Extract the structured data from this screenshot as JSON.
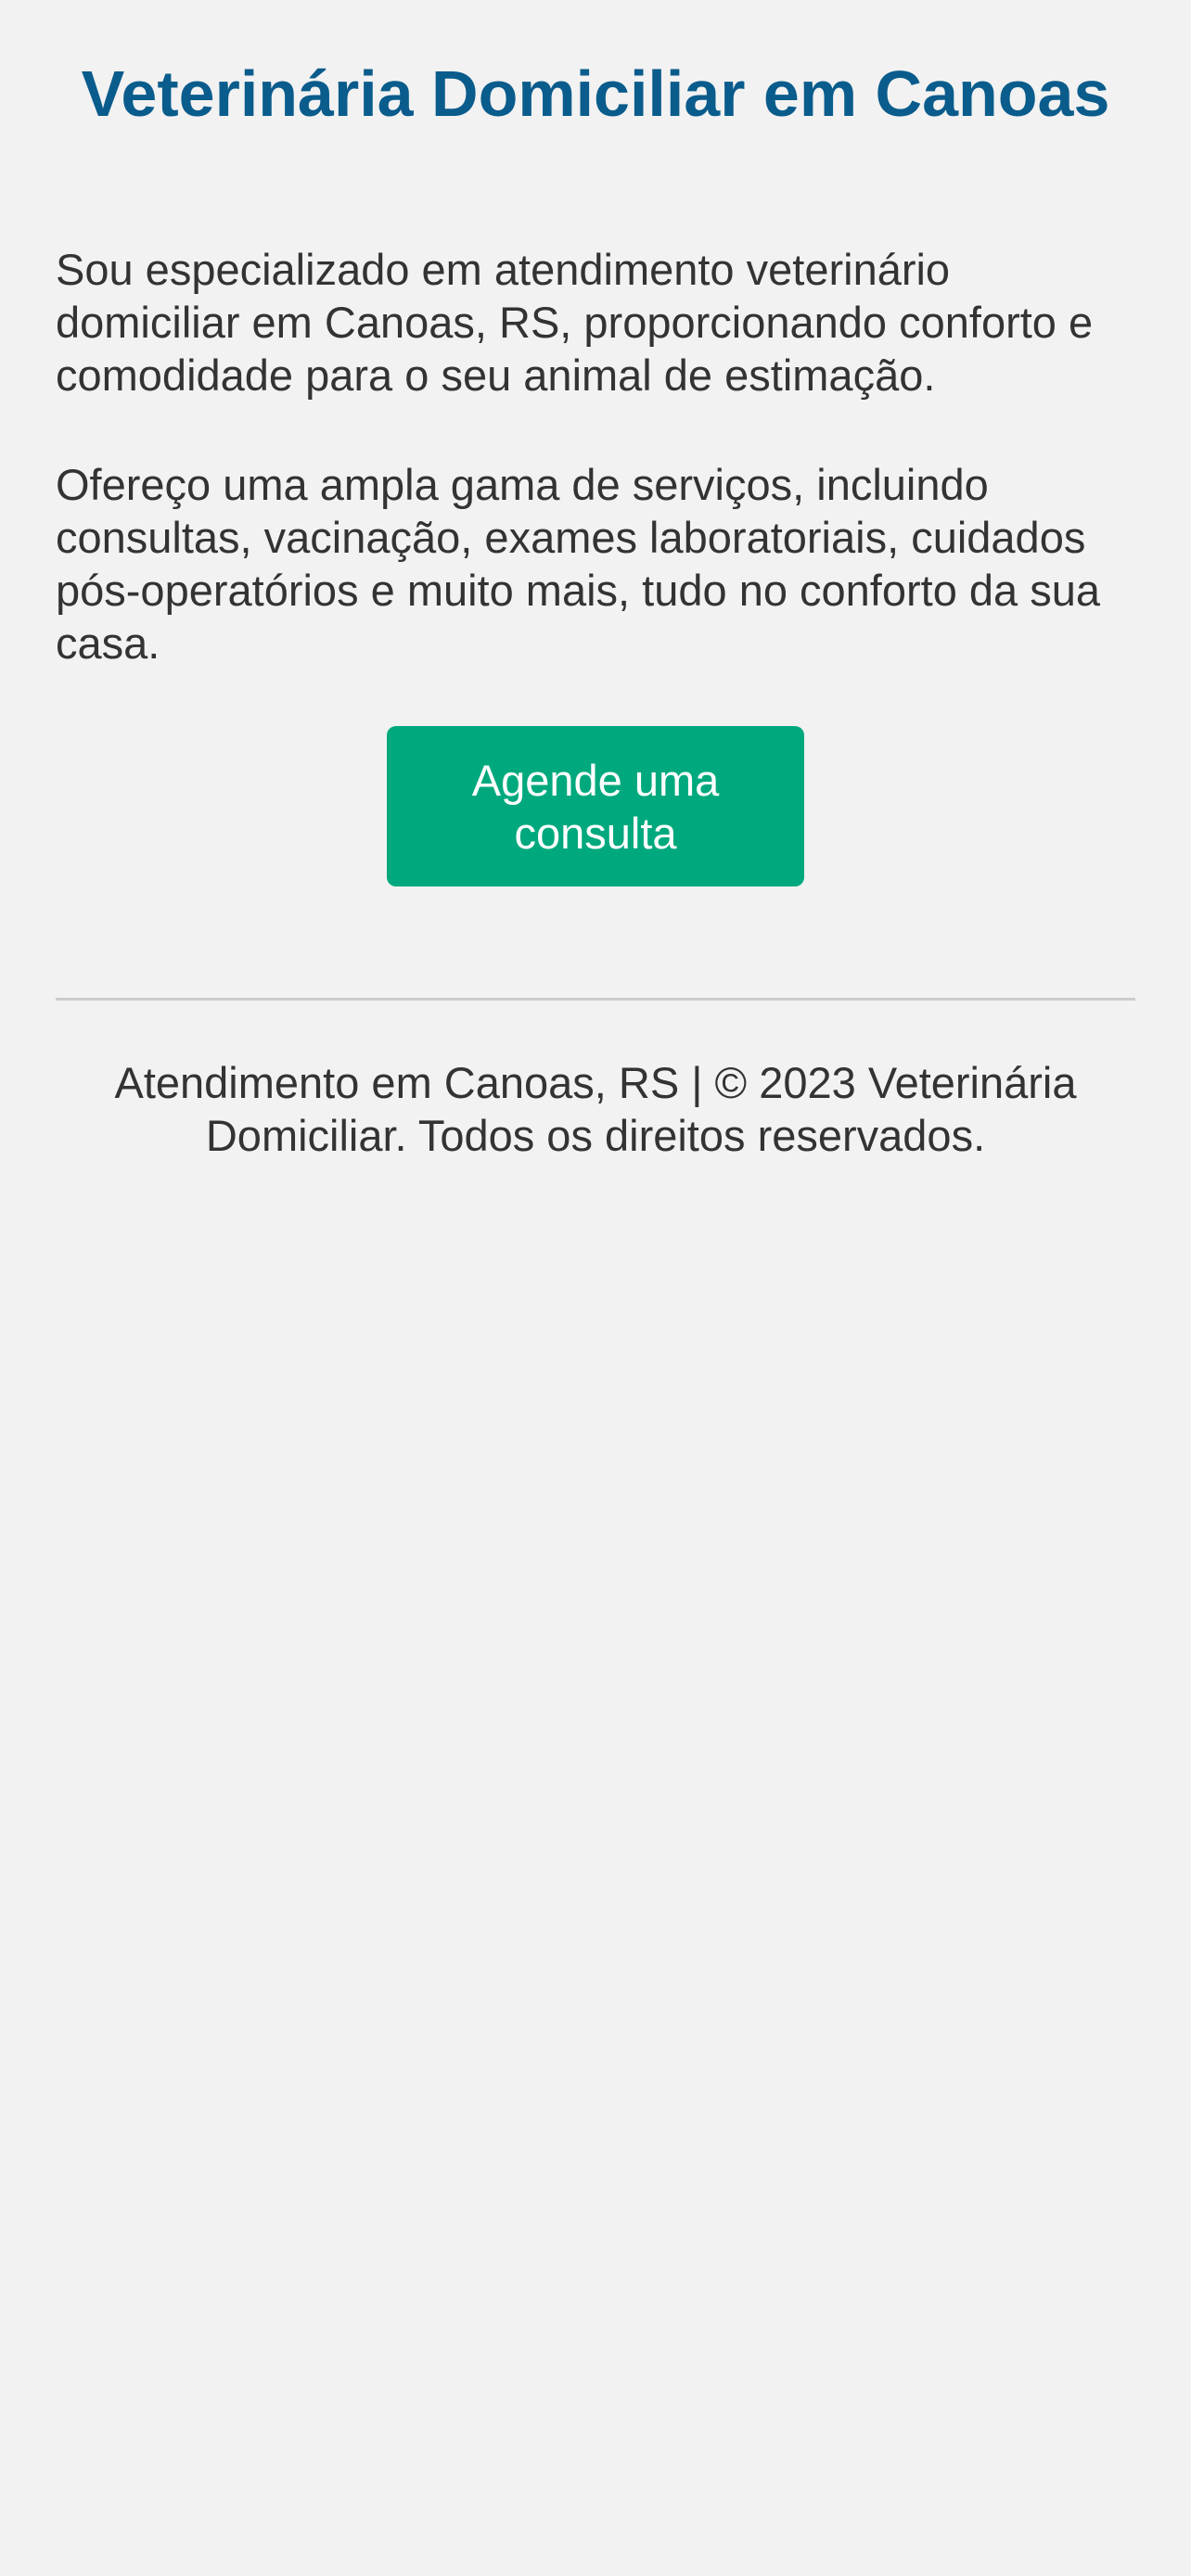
{
  "header": {
    "title": "Veterinária Domiciliar em Canoas"
  },
  "main": {
    "intro_text": "Sou especializado em atendimento veterinário domiciliar em Canoas, RS, proporcionando conforto e comodidade para o seu animal de estimação.",
    "services_text": "Ofereço uma ampla gama de serviços, incluindo consultas, vacinação, exames laboratoriais, cuidados pós-operatórios e muito mais, tudo no conforto da sua casa.",
    "cta_label": "Agende uma consulta"
  },
  "footer": {
    "text": "Atendimento em Canoas, RS | © 2023 Veterinária Domiciliar. Todos os direitos reservados."
  },
  "colors": {
    "title": "#0a5c8c",
    "cta_background": "#00a97d",
    "page_background": "#f2f2f2",
    "body_text": "#333333"
  }
}
